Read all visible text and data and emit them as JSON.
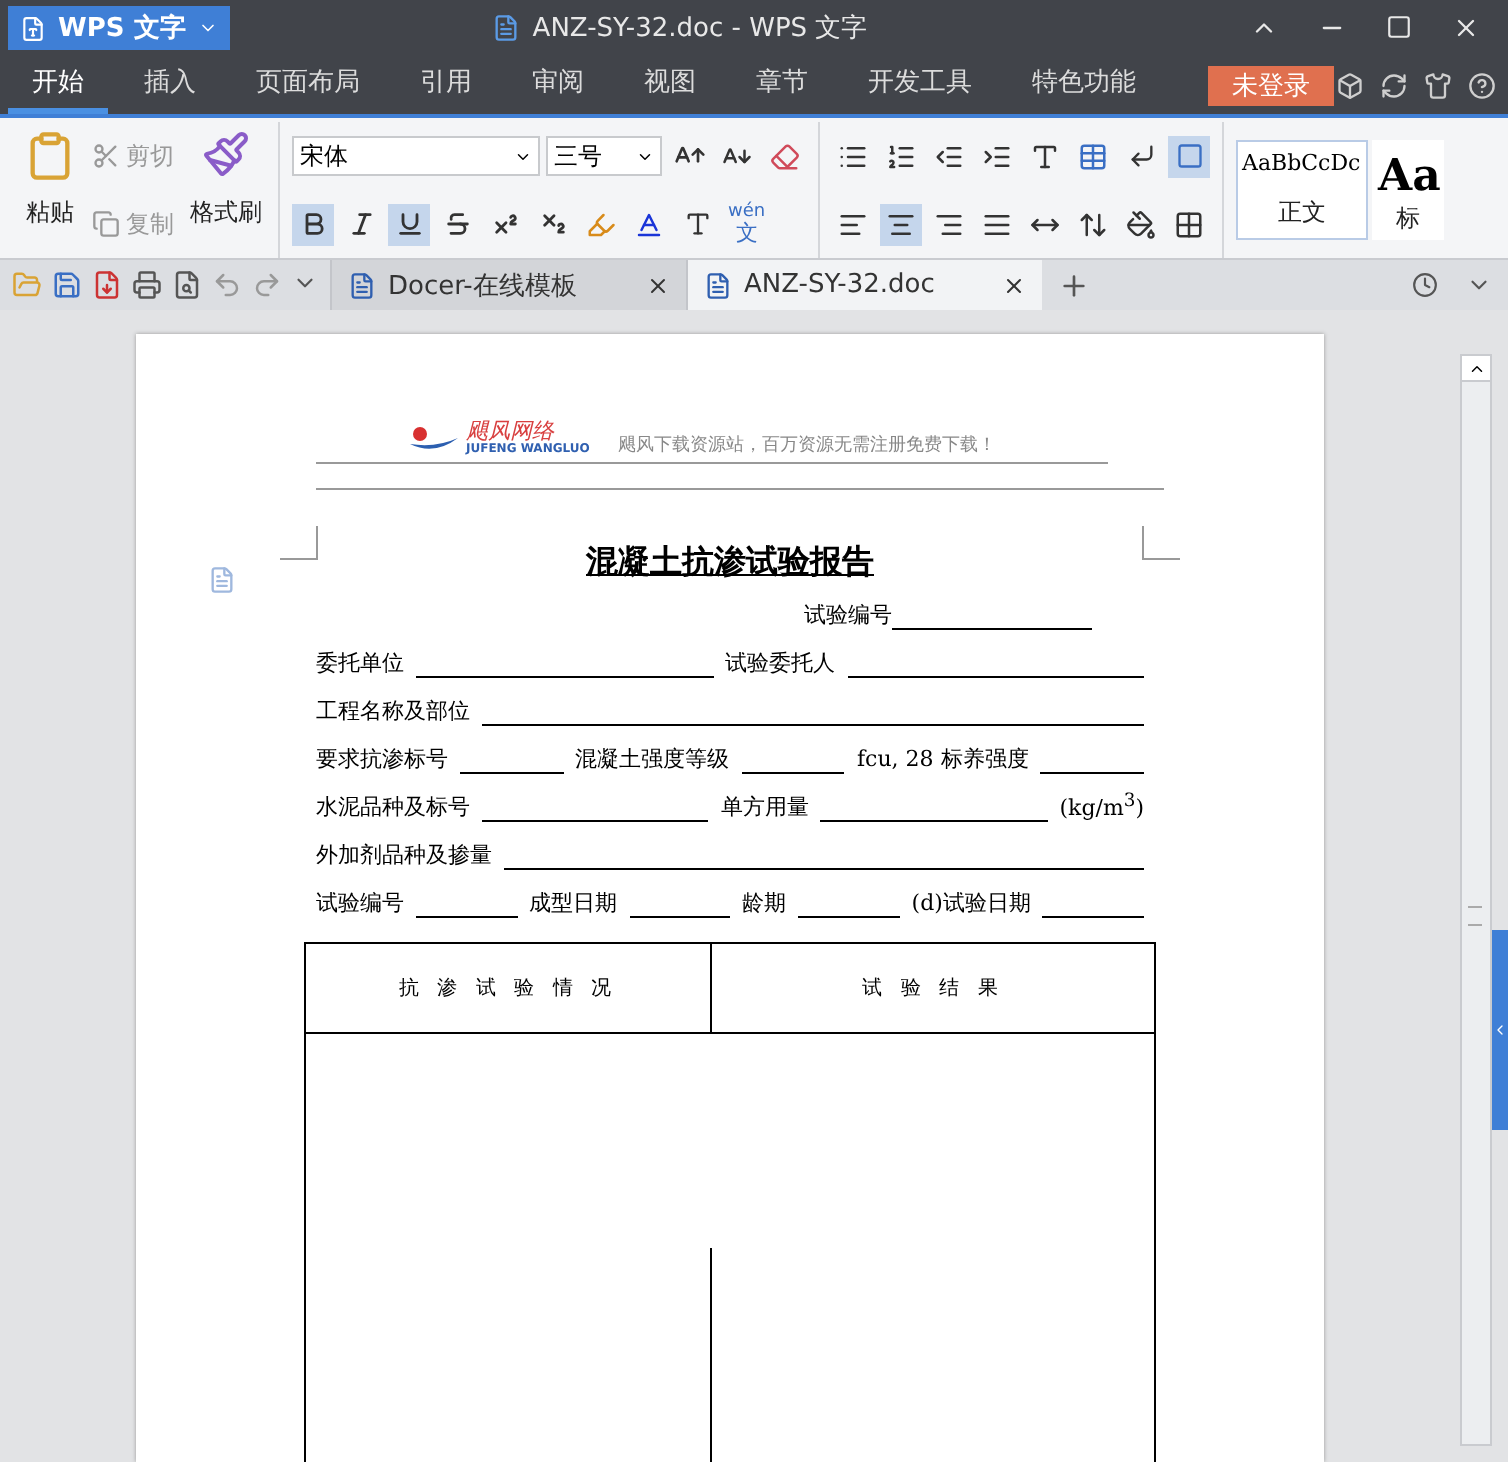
{
  "app_button": {
    "label": "WPS 文字"
  },
  "window_title": "ANZ-SY-32.doc - WPS 文字",
  "menu_tabs": [
    {
      "label": "开始",
      "selected": true
    },
    {
      "label": "插入",
      "selected": false
    },
    {
      "label": "页面布局",
      "selected": false
    },
    {
      "label": "引用",
      "selected": false
    },
    {
      "label": "审阅",
      "selected": false
    },
    {
      "label": "视图",
      "selected": false
    },
    {
      "label": "章节",
      "selected": false
    },
    {
      "label": "开发工具",
      "selected": false
    },
    {
      "label": "特色功能",
      "selected": false
    }
  ],
  "login_button": "未登录",
  "clipboard": {
    "paste": "粘贴",
    "cut": "剪切",
    "copy": "复制",
    "format_painter": "格式刷"
  },
  "font": {
    "name": "宋体",
    "size": "三号"
  },
  "font_toggles": [
    {
      "kind": "bold",
      "active": true
    },
    {
      "kind": "italic",
      "active": false
    },
    {
      "kind": "underline",
      "active": true
    },
    {
      "kind": "strikethrough",
      "active": false
    },
    {
      "kind": "superscript",
      "active": false
    },
    {
      "kind": "subscript",
      "active": false
    }
  ],
  "phonetic_guide": {
    "pinyin": "wén",
    "character": "文"
  },
  "alignment": [
    {
      "kind": "left",
      "selected": false
    },
    {
      "kind": "center",
      "selected": true
    },
    {
      "kind": "right",
      "selected": false
    },
    {
      "kind": "justify",
      "selected": false
    },
    {
      "kind": "distributed",
      "selected": false
    }
  ],
  "styles": [
    {
      "sample": "AaBbCcDc",
      "name": "正文"
    },
    {
      "sample": "Aa",
      "name": "标"
    }
  ],
  "doc_tabs": [
    {
      "label": "Docer-在线模板",
      "selected": false
    },
    {
      "label": "ANZ-SY-32.doc",
      "selected": true
    }
  ],
  "document": {
    "header_logo": {
      "name": "飓风网络",
      "subtitle": "JUFENG  WANGLUO"
    },
    "header_slogan": "飓风下载资源站，百万资源无需注册免费下载！",
    "title": "混凝土抗渗试验报告",
    "report_number_label": "试验编号",
    "form_rows": [
      [
        {
          "kind": "label",
          "text": "委托单位"
        },
        {
          "kind": "blank"
        },
        {
          "kind": "label",
          "text": "试验委托人"
        },
        {
          "kind": "blank"
        }
      ],
      [
        {
          "kind": "label",
          "text": "工程名称及部位"
        },
        {
          "kind": "blank"
        }
      ],
      [
        {
          "kind": "label",
          "text": "要求抗渗标号"
        },
        {
          "kind": "blank"
        },
        {
          "kind": "label",
          "text": "混凝土强度等级"
        },
        {
          "kind": "blank"
        },
        {
          "kind": "label",
          "text": "fcu, 28 标养强度"
        },
        {
          "kind": "blank"
        }
      ],
      [
        {
          "kind": "label",
          "text": "水泥品种及标号"
        },
        {
          "kind": "blank"
        },
        {
          "kind": "label",
          "text": "单方用量"
        },
        {
          "kind": "blank"
        },
        {
          "kind": "label",
          "text": "(kg/m$^{3}$)"
        }
      ],
      [
        {
          "kind": "label",
          "text": "外加剂品种及掺量"
        },
        {
          "kind": "blank"
        }
      ],
      [
        {
          "kind": "label",
          "text": "试验编号"
        },
        {
          "kind": "blank"
        },
        {
          "kind": "label",
          "text": "成型日期"
        },
        {
          "kind": "blank"
        },
        {
          "kind": "label",
          "text": "龄期"
        },
        {
          "kind": "blank"
        },
        {
          "kind": "label",
          "text": "(d)试验日期"
        },
        {
          "kind": "blank"
        }
      ]
    ],
    "table_headers": [
      "抗 渗 试 验 情 况",
      "试 验 结 果"
    ]
  }
}
